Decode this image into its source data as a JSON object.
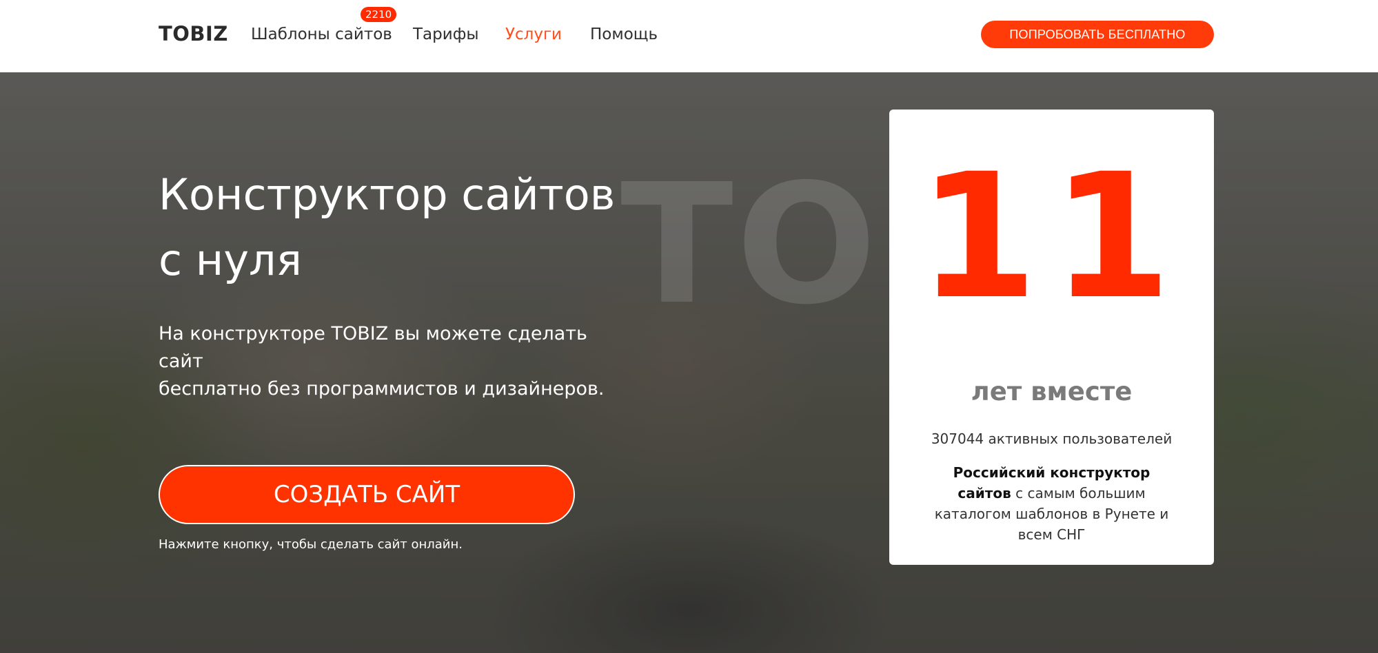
{
  "header": {
    "logo": "TOBIZ",
    "nav": {
      "templates": "Шаблоны сайтов",
      "templates_badge": "2210",
      "tariffs": "Тарифы",
      "services": "Услуги",
      "help": "Помощь"
    },
    "try_button": "ПОПРОБОВАТЬ БЕСПЛАТНО"
  },
  "hero": {
    "watermark": "TOBIZ",
    "title_line1": "Конструктор сайтов",
    "title_line2": "с нуля",
    "subtitle_line1": "На конструкторе TOBIZ вы можете сделать сайт",
    "subtitle_line2": "бесплатно без программистов и дизайнеров.",
    "create_button": "СОЗДАТЬ САЙТ",
    "hint": "Нажмите кнопку, чтобы сделать сайт онлайн."
  },
  "stats": {
    "number": "11",
    "years_label": "лет вместе",
    "users": "307044 активных пользователей",
    "desc_bold": "Российский конструктор сайтов",
    "desc_rest": " с самым большим каталогом шаблонов в Рунете и всем СНГ"
  },
  "colors": {
    "accent": "#ff3300",
    "active_nav": "#ff4d1c",
    "badge": "#ff2a00"
  }
}
